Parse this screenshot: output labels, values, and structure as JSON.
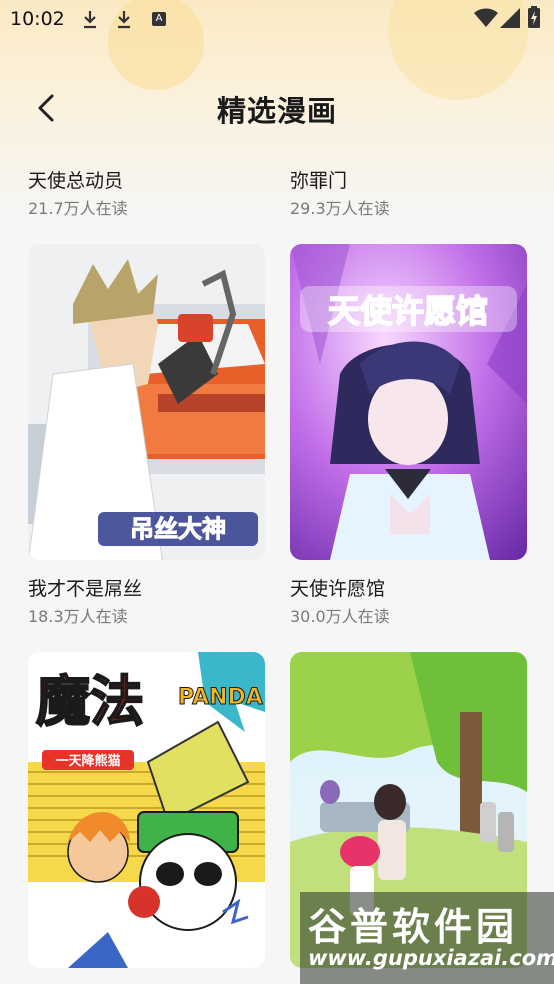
{
  "status_bar": {
    "time": "10:02",
    "badge_letter": "A"
  },
  "header": {
    "title": "精选漫画"
  },
  "partial_row": [
    {
      "title": "天使总动员",
      "readers": "21.7万人在读"
    },
    {
      "title": "弥罪门",
      "readers": "29.3万人在读"
    }
  ],
  "comics": [
    {
      "title": "我才不是屌丝",
      "readers": "18.3万人在读",
      "cover_text": "吊丝大神"
    },
    {
      "title": "天使许愿馆",
      "readers": "30.0万人在读",
      "cover_text": "天使许愿馆"
    },
    {
      "title": "",
      "readers": "",
      "cover_text_main": "魔法",
      "cover_text_side": "PANDA",
      "cover_text_sub": "一天降熊猫"
    },
    {
      "title": "",
      "readers": "",
      "cover_text": ""
    }
  ],
  "watermark": {
    "main": "谷普软件园",
    "sub": "www.gupuxiazai.com"
  }
}
